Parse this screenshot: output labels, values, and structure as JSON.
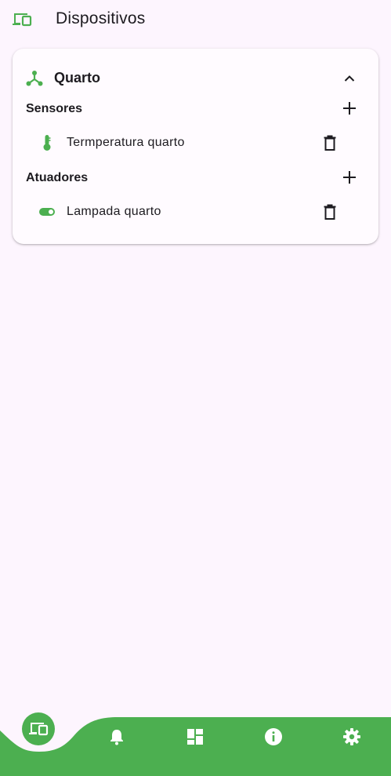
{
  "app_bar": {
    "title": "Dispositivos",
    "icon": "devices-icon"
  },
  "colors": {
    "accent": "#4caf50",
    "background": "#fdf5fe",
    "card": "#fffbff",
    "text": "#1d1b20"
  },
  "group": {
    "name": "Quarto",
    "icon": "hub-icon",
    "expanded": true,
    "sections": [
      {
        "title": "Sensores",
        "items": [
          {
            "label": "Termperatura quarto",
            "icon": "thermometer-icon"
          }
        ]
      },
      {
        "title": "Atuadores",
        "items": [
          {
            "label": "Lampada quarto",
            "icon": "toggle-on-icon"
          }
        ]
      }
    ]
  },
  "bottom_nav": {
    "selected": "devices",
    "items": [
      {
        "id": "devices",
        "icon": "devices-icon"
      },
      {
        "id": "notifications",
        "icon": "bell-icon"
      },
      {
        "id": "dashboard",
        "icon": "dashboard-icon"
      },
      {
        "id": "info",
        "icon": "info-icon"
      },
      {
        "id": "settings",
        "icon": "gear-icon"
      }
    ]
  }
}
